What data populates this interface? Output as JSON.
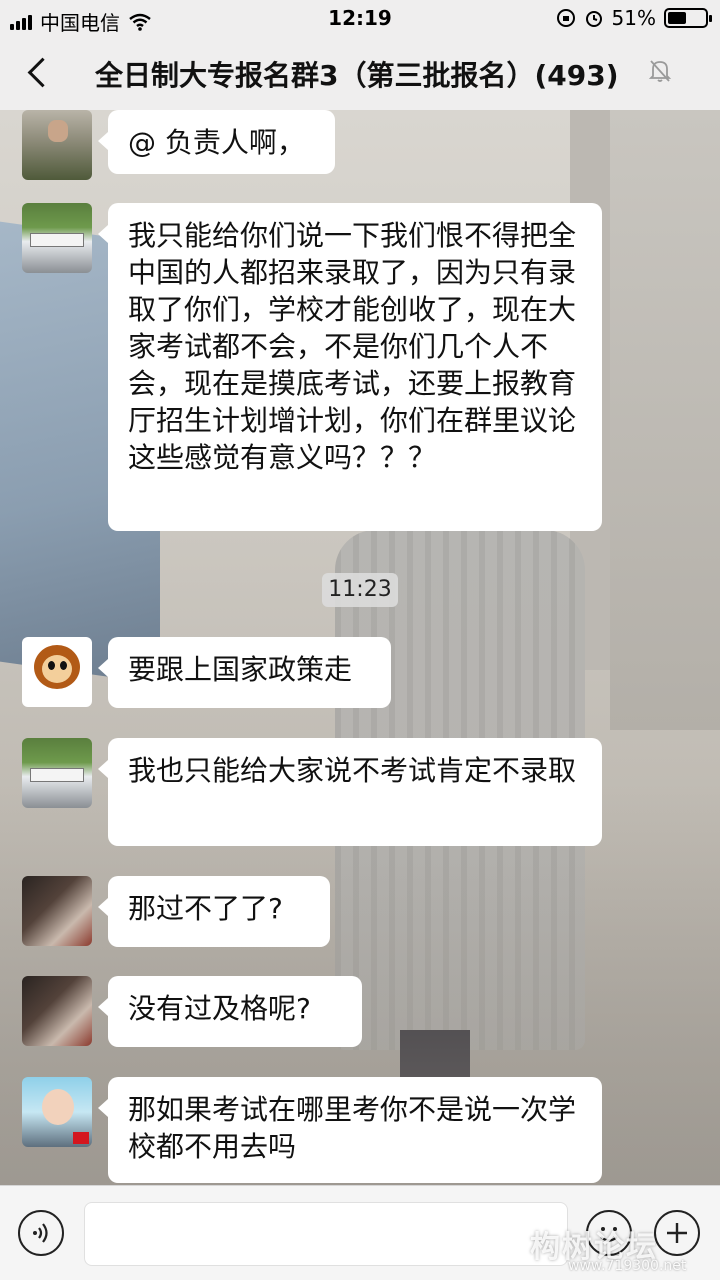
{
  "status_bar": {
    "carrier": "中国电信",
    "time": "12:19",
    "battery_text": "51%",
    "battery_level": 0.51
  },
  "nav": {
    "title": "全日制大专报名群3（第三批报名）(493)"
  },
  "messages": [
    {
      "avatar": "soldier-avatar",
      "text": "@ 负责人啊，"
    },
    {
      "avatar": "school-avatar",
      "text": "我只能给你们说一下我们恨不得把全中国的人都招来录取了，因为只有录取了你们，学校才能创收了，现在大家考试都不会，不是你们几个人不会，现在是摸底考试，还要上报教育厅招生计划增计划，你们在群里议论这些感觉有意义吗？？？"
    },
    {
      "avatar": "monkey-avatar",
      "text": "要跟上国家政策走"
    },
    {
      "avatar": "school-avatar",
      "text": "我也只能给大家说不考试肯定不录取"
    },
    {
      "avatar": "girl-avatar",
      "text": "那过不了了?"
    },
    {
      "avatar": "girl-avatar",
      "text": "没有过及格呢?"
    },
    {
      "avatar": "kid-avatar",
      "text": "那如果考试在哪里考你不是说一次学校都不用去吗"
    }
  ],
  "timestamp": "11:23",
  "watermark": {
    "text": "构树论坛",
    "url": "www.719300.net"
  }
}
